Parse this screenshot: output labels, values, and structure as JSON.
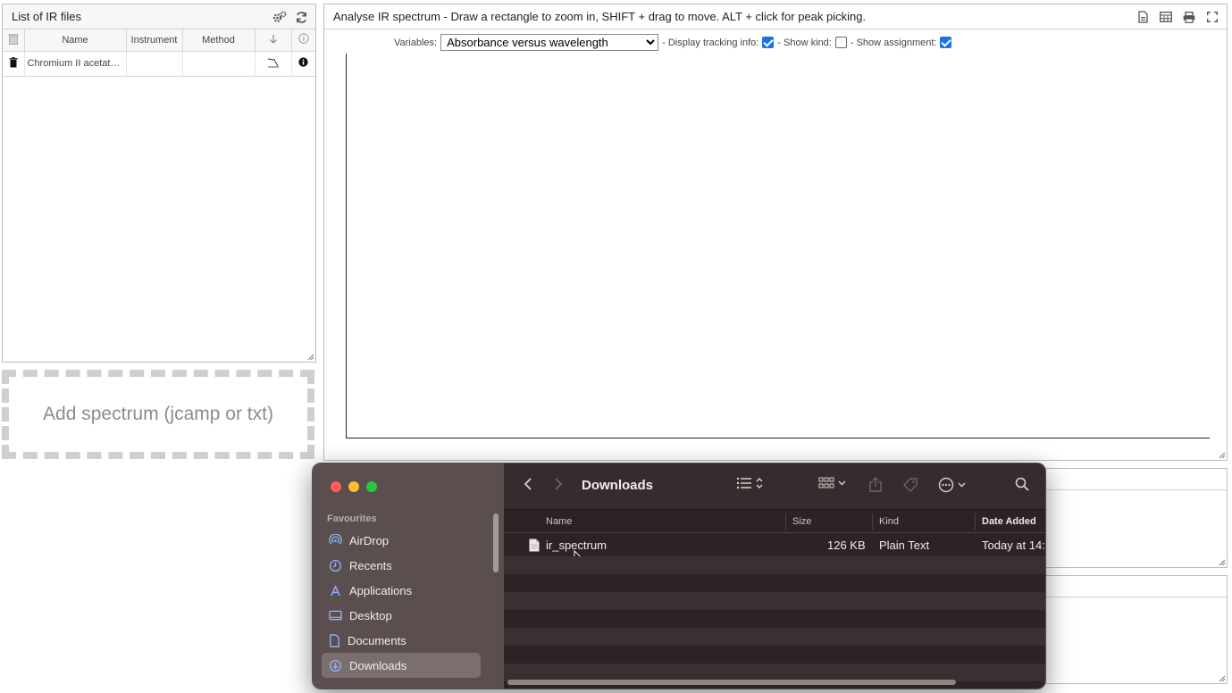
{
  "left_panel": {
    "title": "List of IR files",
    "columns": [
      "Name",
      "Instrument",
      "Method"
    ],
    "rows": [
      {
        "name": "Chromium II acetate...",
        "instrument": "",
        "method": ""
      }
    ]
  },
  "dropzone": {
    "label": "Add spectrum (jcamp or txt)"
  },
  "right_panel": {
    "title": "Analyse IR spectrum - Draw a rectangle to zoom in, SHIFT + drag to move. ALT + click for peak picking.",
    "variables_label": "Variables:",
    "variables_selected": "Absorbance versus wavelength",
    "tracking_label": "- Display tracking info:",
    "tracking_checked": true,
    "kind_label": "- Show kind:",
    "kind_checked": false,
    "assignment_label": "- Show assignment:",
    "assignment_checked": true
  },
  "finder": {
    "title": "Downloads",
    "sidebar_section": "Favourites",
    "sidebar_items": [
      {
        "label": "AirDrop",
        "icon": "airdrop-icon"
      },
      {
        "label": "Recents",
        "icon": "clock-icon"
      },
      {
        "label": "Applications",
        "icon": "applications-icon"
      },
      {
        "label": "Desktop",
        "icon": "desktop-icon"
      },
      {
        "label": "Documents",
        "icon": "document-icon"
      },
      {
        "label": "Downloads",
        "icon": "downloads-icon"
      }
    ],
    "selected_item": "Downloads",
    "columns": {
      "name": "Name",
      "size": "Size",
      "kind": "Kind",
      "date": "Date Added"
    },
    "files": [
      {
        "name": "ir_spectrum",
        "size": "126 KB",
        "kind": "Plain Text",
        "date": "Today at 14:"
      }
    ]
  },
  "colors": {
    "accent": "#1a73e8",
    "traffic_red": "#ff5f57",
    "traffic_yellow": "#febc2e",
    "traffic_green": "#28c840",
    "finder_sidebar": "#5b4e4f",
    "finder_main": "#2d2324"
  }
}
